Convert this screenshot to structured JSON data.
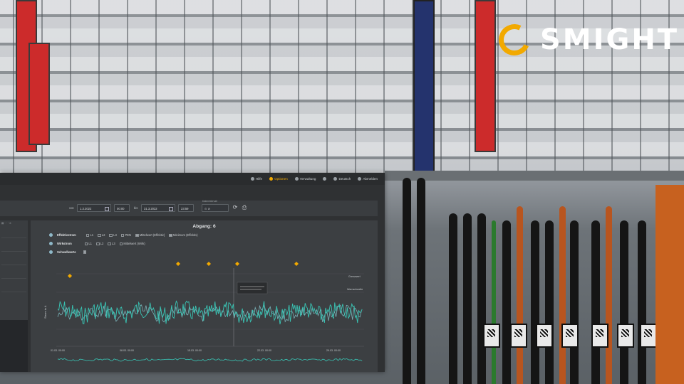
{
  "brand": {
    "logo_text": "SMIGHT",
    "accent": "#f2a900"
  },
  "app": {
    "nav": [
      {
        "label": "Hilfe",
        "icon": "help-icon",
        "active": false
      },
      {
        "label": "Optionen",
        "icon": "options-icon",
        "active": true
      },
      {
        "label": "Verwaltung",
        "icon": "admin-icon",
        "active": false
      },
      {
        "label": "",
        "icon": "user-icon",
        "active": false
      },
      {
        "label": "Deutsch",
        "icon": "language-icon",
        "active": false
      },
      {
        "label": "Abmelden",
        "icon": "logout-icon",
        "active": false
      }
    ],
    "filter": {
      "from_label": "von",
      "from_date": "1.3.2022",
      "from_time": "00:00",
      "to_label": "bis",
      "to_date": "31.3.2022",
      "to_time": "23:59",
      "interval_label": "Datenintervall"
    },
    "chart_title": "Abgang: 6",
    "legend": {
      "rows": [
        {
          "group": "Effektivstrom",
          "items": [
            "L1",
            "L2",
            "L3",
            "PEN",
            "Mittelwert (Effektiv)",
            "Minimum (Effektiv)"
          ]
        },
        {
          "group": "Wirkstrom",
          "items": [
            "L1",
            "L2",
            "L3",
            "Mittelwert (Wirk)"
          ]
        },
        {
          "group": "Schwellwerte",
          "items": []
        }
      ]
    },
    "y_axis_label": "Strom in A",
    "threshold_labels": [
      "Grenzwert",
      "Warnschwelle"
    ],
    "x_ticks": [
      "01.03. 00:00",
      "08.03. 00:00",
      "15.03. 00:00",
      "22.03. 00:00",
      "29.03. 00:00"
    ],
    "series_colors": {
      "effektiv": "#39c4b4",
      "wirk": "#8fd9e0"
    }
  }
}
